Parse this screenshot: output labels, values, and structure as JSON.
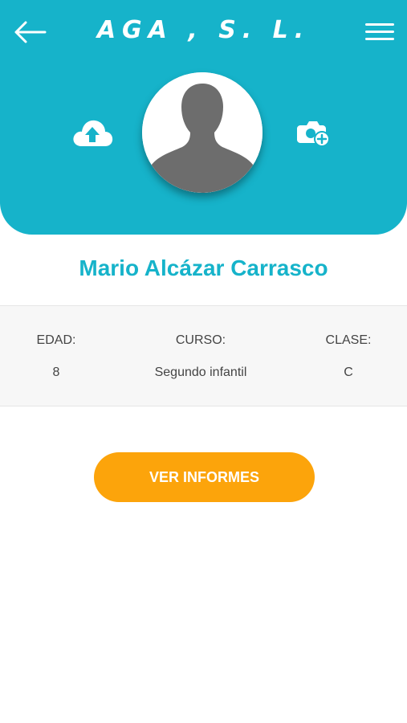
{
  "app": {
    "brand": "AGA , S. L.",
    "header_color": "#16b3ca",
    "accent_color": "#fca40b"
  },
  "header": {
    "back_icon": "arrow-left-icon",
    "menu_icon": "hamburger-menu-icon",
    "upload_icon": "cloud-upload-icon",
    "camera_icon": "camera-add-icon"
  },
  "profile": {
    "name": "Mario Alcázar Carrasco",
    "avatar_icon": "default-user-silhouette"
  },
  "details": {
    "age_label": "EDAD:",
    "age_value": "8",
    "course_label": "CURSO:",
    "course_value": "Segundo infantil",
    "class_label": "CLASE:",
    "class_value": "C"
  },
  "actions": {
    "reports_label": "VER INFORMES"
  }
}
